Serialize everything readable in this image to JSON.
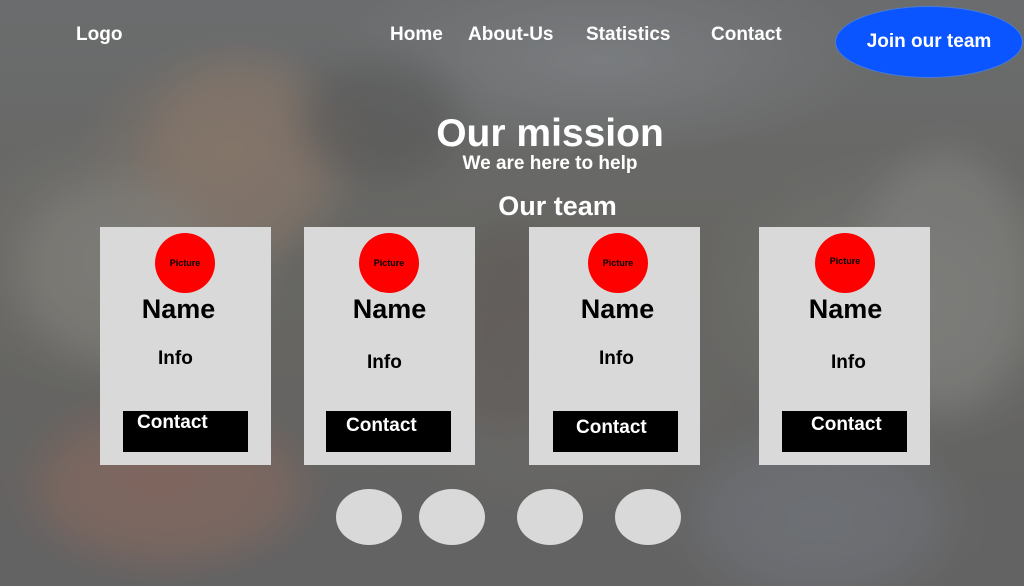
{
  "header": {
    "logo": "Logo",
    "nav": [
      "Home",
      "About-Us",
      "Statistics",
      "Contact"
    ],
    "cta": "Join our team"
  },
  "hero": {
    "title": "Our mission",
    "subtitle": "We are here to help"
  },
  "team": {
    "title": "Our team",
    "members": [
      {
        "picture": "Picture",
        "name": "Name",
        "info": "Info",
        "contact": "Contact"
      },
      {
        "picture": "Picture",
        "name": "Name",
        "info": "Info",
        "contact": "Contact"
      },
      {
        "picture": "Picture",
        "name": "Name",
        "info": "Info",
        "contact": "Contact"
      },
      {
        "picture": "Picture",
        "name": "Name",
        "info": "Info",
        "contact": "Contact"
      }
    ]
  },
  "carousel": {
    "dot_count": 4
  },
  "colors": {
    "cta_background": "#0a55ff",
    "picture_placeholder": "#ff0000",
    "card_background": "#d9d9d9",
    "contact_button": "#000000"
  }
}
